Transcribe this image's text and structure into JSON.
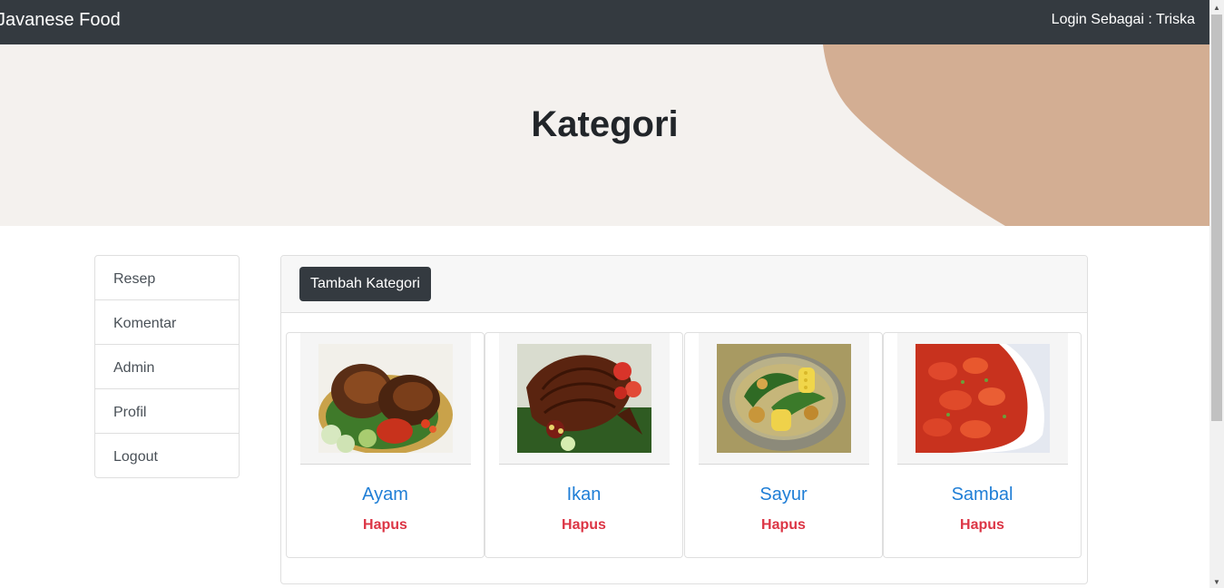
{
  "navbar": {
    "brand": "Javanese Food",
    "login_text": "Login Sebagai : Triska"
  },
  "hero": {
    "title": "Kategori",
    "accent_color": "#d3ae93",
    "background": "#f4f1ee"
  },
  "sidebar": {
    "items": [
      {
        "label": "Resep"
      },
      {
        "label": "Komentar"
      },
      {
        "label": "Admin"
      },
      {
        "label": "Profil"
      },
      {
        "label": "Logout"
      }
    ]
  },
  "toolbar": {
    "add_label": "Tambah Kategori"
  },
  "categories": [
    {
      "name": "Ayam",
      "delete_label": "Hapus",
      "image": "grilled-chicken-photo"
    },
    {
      "name": "Ikan",
      "delete_label": "Hapus",
      "image": "grilled-fish-photo"
    },
    {
      "name": "Sayur",
      "delete_label": "Hapus",
      "image": "vegetable-soup-photo"
    },
    {
      "name": "Sambal",
      "delete_label": "Hapus",
      "image": "shrimp-sambal-photo"
    }
  ],
  "colors": {
    "navbar": "#343a40",
    "link": "#1f7ed6",
    "danger": "#dc3545"
  }
}
